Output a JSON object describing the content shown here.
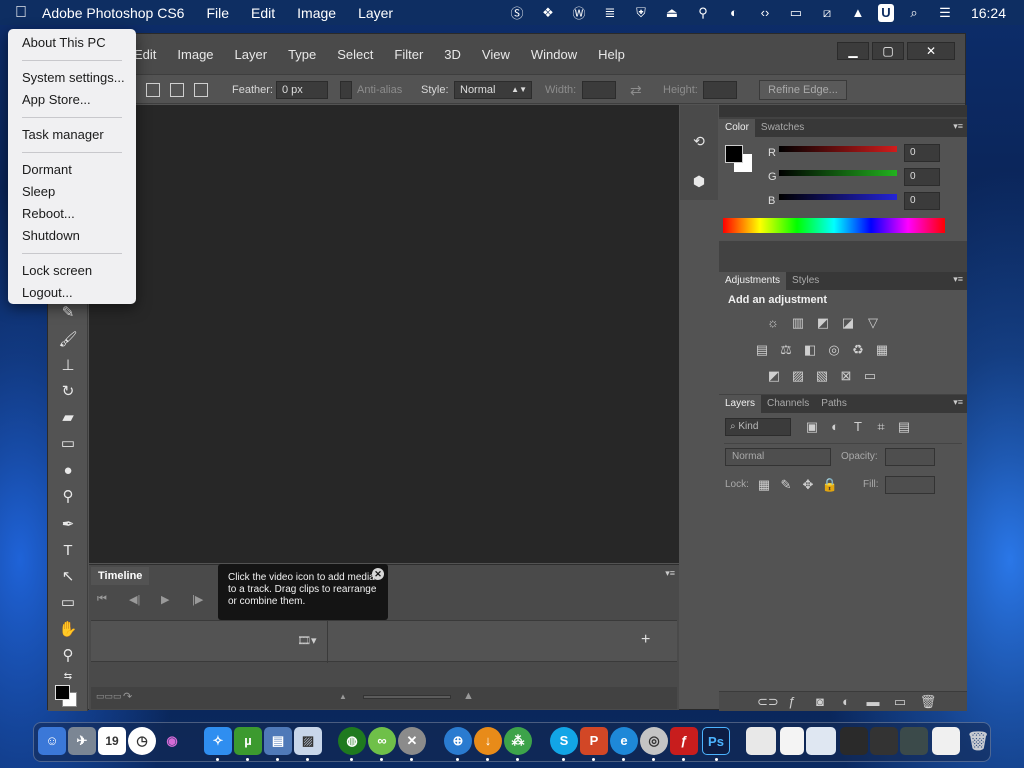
{
  "menubar": {
    "app_name": "Adobe Photoshop CS6",
    "items": [
      "File",
      "Edit",
      "Image",
      "Layer"
    ],
    "clock": "16:24",
    "tray_icons": [
      "skype-icon",
      "dropbox-icon",
      "wordpress-icon",
      "stack-icon",
      "shield-icon",
      "eject-icon",
      "usb-icon",
      "contrast-icon",
      "code-icon",
      "monitor-icon",
      "network-off-icon",
      "arrow-up-icon",
      "u-icon",
      "search-icon",
      "control-center-icon"
    ]
  },
  "apple_menu": {
    "groups": [
      [
        "About This PC"
      ],
      [
        "System settings...",
        "App Store..."
      ],
      [
        "Task manager"
      ],
      [
        "Dormant",
        "Sleep",
        "Reboot...",
        "Shutdown"
      ],
      [
        "Lock screen",
        "Logout..."
      ]
    ]
  },
  "ps": {
    "menu": [
      "Edit",
      "Image",
      "Layer",
      "Type",
      "Select",
      "Filter",
      "3D",
      "View",
      "Window",
      "Help"
    ],
    "options": {
      "feather_label": "Feather:",
      "feather_value": "0 px",
      "antialias_label": "Anti-alias",
      "style_label": "Style:",
      "style_value": "Normal",
      "width_label": "Width:",
      "height_label": "Height:",
      "refine_edge": "Refine Edge..."
    },
    "timeline": {
      "tab": "Timeline",
      "tooltip": "Click the video icon to add media to a track. Drag clips to rearrange or combine them."
    },
    "color_panel": {
      "tabs": [
        "Color",
        "Swatches"
      ],
      "channels": [
        {
          "label": "R",
          "value": "0",
          "color": "#d21c1c"
        },
        {
          "label": "G",
          "value": "0",
          "color": "#22b21f"
        },
        {
          "label": "B",
          "value": "0",
          "color": "#2424d6"
        }
      ]
    },
    "adjustments_panel": {
      "tabs": [
        "Adjustments",
        "Styles"
      ],
      "title": "Add an adjustment"
    },
    "layers_panel": {
      "tabs": [
        "Layers",
        "Channels",
        "Paths"
      ],
      "kind_label": "Kind",
      "blend_mode": "Normal",
      "opacity_label": "Opacity:",
      "lock_label": "Lock:",
      "fill_label": "Fill:"
    }
  },
  "dock": {
    "apps": [
      "finder",
      "launchpad",
      "calendar",
      "clock",
      "siri",
      "safari",
      "utorrent",
      "word-app",
      "preview",
      "collabtive",
      "link-app",
      "tools",
      "network",
      "download",
      "app-green",
      "skype",
      "powerpoint",
      "internet-explorer",
      "dvd",
      "flash",
      "photoshop",
      "window-thumb-1",
      "window-thumb-2",
      "window-thumb-3",
      "window-thumb-4",
      "window-thumb-5",
      "window-thumb-6",
      "window-thumb-7",
      "trash"
    ],
    "calendar_day": "19"
  }
}
